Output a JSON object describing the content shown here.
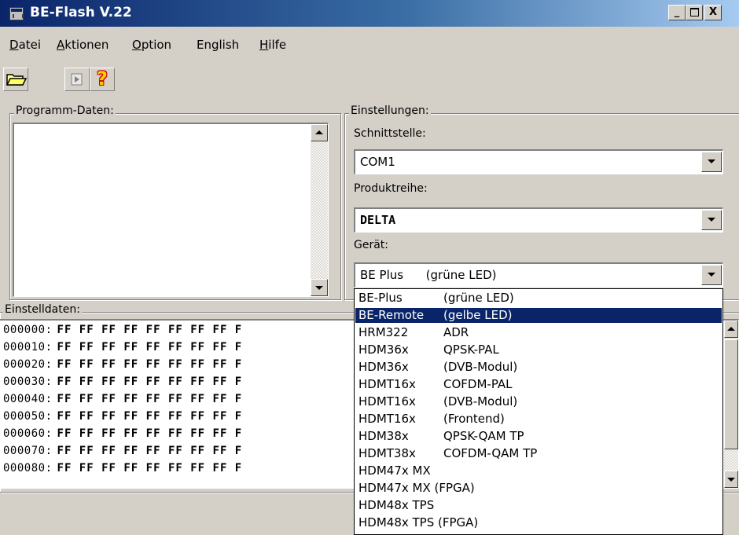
{
  "window": {
    "title": "BE-Flash V.22",
    "minimize": "_",
    "maximize": "□",
    "close": "X"
  },
  "menu": [
    {
      "label": "Datei",
      "accel": "D",
      "rest": "atei"
    },
    {
      "label": "Aktionen",
      "accel": "A",
      "rest": "ktionen"
    },
    {
      "label": "Option",
      "accel": "O",
      "rest": "ption"
    },
    {
      "label": "English",
      "accel": "",
      "rest": "English"
    },
    {
      "label": "Hilfe",
      "accel": "H",
      "rest": "ilfe"
    }
  ],
  "toolbar": {
    "open_icon": "folder-open-icon",
    "run_icon": "play-icon",
    "help_icon": "question-icon",
    "help_glyph": "?"
  },
  "program_group": {
    "label": "Programm-Daten:"
  },
  "settings": {
    "label": "Einstellungen:",
    "interface_label": "Schnittstelle:",
    "interface_value": "COM1",
    "product_label": "Produktreihe:",
    "product_value": "DELTA",
    "device_label": "Gerät:",
    "device_value": "BE Plus      (grüne LED)"
  },
  "settings_data": {
    "label": "Einstelldaten:",
    "rows": [
      {
        "addr": "000000:",
        "bytes": "FF FF FF FF FF FF FF FF F"
      },
      {
        "addr": "000010:",
        "bytes": "FF FF FF FF FF FF FF FF F"
      },
      {
        "addr": "000020:",
        "bytes": "FF FF FF FF FF FF FF FF F"
      },
      {
        "addr": "000030:",
        "bytes": "FF FF FF FF FF FF FF FF F"
      },
      {
        "addr": "000040:",
        "bytes": "FF FF FF FF FF FF FF FF F"
      },
      {
        "addr": "000050:",
        "bytes": "FF FF FF FF FF FF FF FF F"
      },
      {
        "addr": "000060:",
        "bytes": "FF FF FF FF FF FF FF FF F"
      },
      {
        "addr": "000070:",
        "bytes": "FF FF FF FF FF FF FF FF F"
      },
      {
        "addr": "000080:",
        "bytes": "FF FF FF FF FF FF FF FF F"
      }
    ]
  },
  "device_options": [
    {
      "code": "BE-Plus",
      "desc": "(grüne LED)",
      "selected": false
    },
    {
      "code": "BE-Remote",
      "desc": "(gelbe LED)",
      "selected": true
    },
    {
      "code": "HRM322",
      "desc": "ADR",
      "selected": false
    },
    {
      "code": "HDM36x",
      "desc": "QPSK-PAL",
      "selected": false
    },
    {
      "code": "HDM36x",
      "desc": "(DVB-Modul)",
      "selected": false
    },
    {
      "code": "HDMT16x",
      "desc": "COFDM-PAL",
      "selected": false
    },
    {
      "code": "HDMT16x",
      "desc": "(DVB-Modul)",
      "selected": false
    },
    {
      "code": "HDMT16x",
      "desc": "(Frontend)",
      "selected": false
    },
    {
      "code": "HDM38x",
      "desc": "QPSK-QAM TP",
      "selected": false
    },
    {
      "code": "HDMT38x",
      "desc": "COFDM-QAM TP",
      "selected": false
    },
    {
      "code": "HDM47x MX",
      "desc": "",
      "selected": false
    },
    {
      "code": "HDM47x MX (FPGA)",
      "desc": "",
      "selected": false
    },
    {
      "code": "HDM48x TPS",
      "desc": "",
      "selected": false
    },
    {
      "code": "HDM48x TPS (FPGA)",
      "desc": "",
      "selected": false
    }
  ]
}
